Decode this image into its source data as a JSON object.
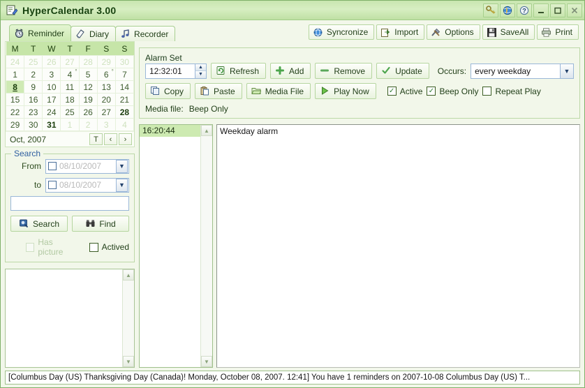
{
  "window": {
    "title": "HyperCalendar 3.00",
    "title_icon": "note-edit-icon",
    "buttons": [
      {
        "name": "key-button",
        "glyph": "⚷",
        "label": "Key"
      },
      {
        "name": "web-button",
        "glyph": "◉",
        "label": "Web"
      },
      {
        "name": "help-button",
        "glyph": "?",
        "label": "Help"
      },
      {
        "name": "minimize-button",
        "glyph": "–",
        "label": "Minimize"
      },
      {
        "name": "maximize-button",
        "glyph": "□",
        "label": "Maximize"
      },
      {
        "name": "close-button",
        "glyph": "✕",
        "label": "Close"
      }
    ]
  },
  "tabs": [
    {
      "label": "Reminder",
      "icon": "alarm-clock-icon",
      "active": true
    },
    {
      "label": "Diary",
      "icon": "diary-pen-icon",
      "active": false
    },
    {
      "label": "Recorder",
      "icon": "music-note-icon",
      "active": false
    }
  ],
  "toolbar": [
    {
      "label": "Syncronize",
      "icon": "globe-sync-icon"
    },
    {
      "label": "Import",
      "icon": "import-folder-icon"
    },
    {
      "label": "Options",
      "icon": "tools-icon"
    },
    {
      "label": "SaveAll",
      "icon": "floppy-disk-icon"
    },
    {
      "label": "Print",
      "icon": "printer-icon"
    }
  ],
  "calendar": {
    "weekday_headers": [
      "M",
      "T",
      "W",
      "T",
      "F",
      "S",
      "S"
    ],
    "month_label": "Oct, 2007",
    "nav": {
      "today": "T",
      "prev": "‹",
      "next": "›"
    },
    "weeks": [
      [
        {
          "d": "24",
          "dim": true
        },
        {
          "d": "25",
          "dim": true
        },
        {
          "d": "26",
          "dim": true
        },
        {
          "d": "27",
          "dim": true
        },
        {
          "d": "28",
          "dim": true
        },
        {
          "d": "29",
          "dim": true
        },
        {
          "d": "30",
          "dim": true
        }
      ],
      [
        {
          "d": "1"
        },
        {
          "d": "2"
        },
        {
          "d": "3"
        },
        {
          "d": "4",
          "mark": "°"
        },
        {
          "d": "5"
        },
        {
          "d": "6",
          "mark": "°"
        },
        {
          "d": "7"
        }
      ],
      [
        {
          "d": "8",
          "sel": true
        },
        {
          "d": "9"
        },
        {
          "d": "10"
        },
        {
          "d": "11"
        },
        {
          "d": "12"
        },
        {
          "d": "13"
        },
        {
          "d": "14"
        }
      ],
      [
        {
          "d": "15"
        },
        {
          "d": "16"
        },
        {
          "d": "17"
        },
        {
          "d": "18"
        },
        {
          "d": "19"
        },
        {
          "d": "20"
        },
        {
          "d": "21"
        }
      ],
      [
        {
          "d": "22"
        },
        {
          "d": "23"
        },
        {
          "d": "24"
        },
        {
          "d": "25"
        },
        {
          "d": "26"
        },
        {
          "d": "27"
        },
        {
          "d": "28",
          "bold": true
        }
      ],
      [
        {
          "d": "29"
        },
        {
          "d": "30"
        },
        {
          "d": "31",
          "bold": true
        },
        {
          "d": "1",
          "dim": true
        },
        {
          "d": "2",
          "dim": true
        },
        {
          "d": "3",
          "dim": true
        },
        {
          "d": "4",
          "dim": true
        }
      ]
    ]
  },
  "search": {
    "legend": "Search",
    "from_label": "From",
    "from_value": "08/10/2007",
    "from_checked": false,
    "to_label": "to",
    "to_value": "08/10/2007",
    "to_checked": false,
    "keyword_value": "",
    "keyword_placeholder": "",
    "search_button": "Search",
    "search_icon": "search-icon",
    "find_button": "Find",
    "find_icon": "binoculars-icon",
    "has_picture_label": "Has picture",
    "has_picture_checked": false,
    "has_picture_disabled": true,
    "actived_label": "Actived",
    "actived_checked": false
  },
  "alarm_set": {
    "legend": "Alarm Set",
    "time_value": "12:32:01",
    "buttons_row1": [
      {
        "label": "Refresh",
        "icon": "refresh-icon"
      },
      {
        "label": "Add",
        "icon": "plus-icon"
      },
      {
        "label": "Remove",
        "icon": "minus-icon"
      },
      {
        "label": "Update",
        "icon": "check-icon"
      }
    ],
    "occurs_label": "Occurs:",
    "occurs_value": "every weekday",
    "buttons_row2": [
      {
        "label": "Copy",
        "icon": "copy-icon"
      },
      {
        "label": "Paste",
        "icon": "paste-icon"
      },
      {
        "label": "Media File",
        "icon": "folder-open-icon"
      },
      {
        "label": "Play Now",
        "icon": "play-icon"
      }
    ],
    "checkboxes": [
      {
        "label": "Active",
        "checked": true
      },
      {
        "label": "Beep Only",
        "checked": true
      },
      {
        "label": "Repeat Play",
        "checked": false
      }
    ],
    "media_file_label": "Media file:",
    "media_file_value": "Beep Only"
  },
  "alarm_list": {
    "items": [
      {
        "time": "16:20:44",
        "selected": true
      }
    ]
  },
  "editor": {
    "text": "Weekday alarm"
  },
  "status_bar": {
    "text": "[Columbus Day (US) Thanksgiving Day (Canada)! Monday, October 08, 2007. 12:41] You have 1 reminders on 2007-10-08 Columbus Day (US) T..."
  },
  "colors": {
    "accent_green": "#c6e5a8",
    "title_text": "#17420f",
    "legend_blue": "#2f5fa0",
    "selection": "#cdeab1",
    "window_bg": "#f2f7ea"
  }
}
